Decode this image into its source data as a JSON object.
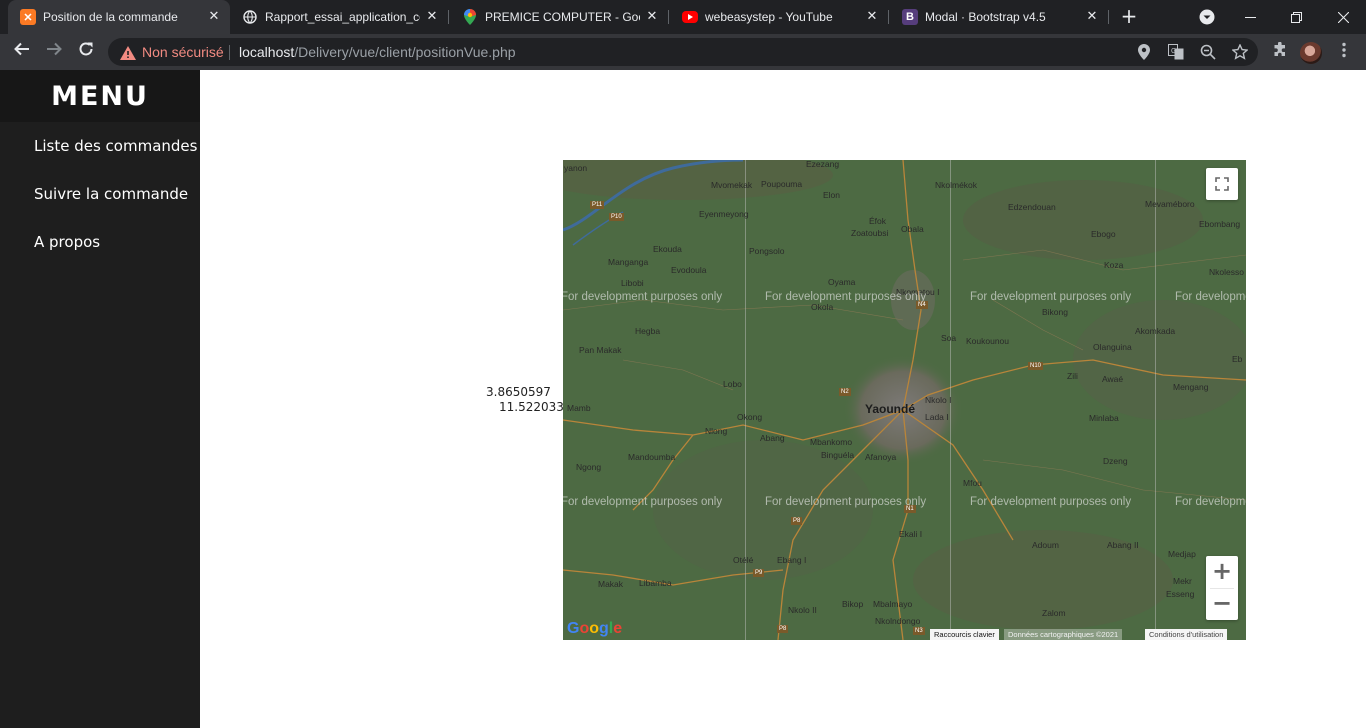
{
  "tabs": [
    {
      "title": "Position de la commande",
      "icon": "xampp-icon",
      "color": "#fb7a24",
      "active": true
    },
    {
      "title": "Rapport_essai_application_co",
      "icon": "globe-icon",
      "color": "#e8eaed"
    },
    {
      "title": "PREMICE COMPUTER - Googl",
      "icon": "google-maps-icon",
      "color": "#34a853"
    },
    {
      "title": "webeasystep - YouTube",
      "icon": "youtube-icon",
      "color": "#ff0000"
    },
    {
      "title": "Modal · Bootstrap v4.5",
      "icon": "bootstrap-icon",
      "color": "#563d7c"
    }
  ],
  "address_bar": {
    "security_label": "Non sécurisé",
    "url_host": "localhost",
    "url_path": "/Delivery/vue/client/positionVue.php"
  },
  "sidebar": {
    "heading": "MENU",
    "items": [
      {
        "label": "Liste des commandes"
      },
      {
        "label": "Suivre la commande"
      },
      {
        "label": "A propos"
      }
    ]
  },
  "position": {
    "latitude": "3.8650597",
    "longitude": "11.5220332"
  },
  "map": {
    "center_label": "Yaoundé",
    "watermark": "For development purposes only",
    "places": [
      "Ezezang",
      "Mvomekak",
      "Poupouma",
      "Nkolmékok",
      "Edzendouan",
      "Mevaméboro",
      "Eyenmeyong",
      "Elon",
      "Éfok",
      "Zoatoubsi",
      "Obala",
      "Ebogo",
      "Ebombang",
      "Ekouda",
      "Manganga",
      "Evodoula",
      "Pongsolo",
      "Koza",
      "Nkolesso",
      "Libobi",
      "Oyama",
      "Nkometou I",
      "Okola",
      "Bikong",
      "Hegba",
      "Soa",
      "Koukounou",
      "Akomkada",
      "Olanguina",
      "Pan Makak",
      "Zili",
      "Awaé",
      "Mengang",
      "Lobo",
      "Nkolo I",
      "Mamb",
      "Okong",
      "Lada I",
      "Minlaba",
      "Nlong",
      "Abang",
      "Mbankomo",
      "Mandoumba",
      "Binguéla",
      "Afanoya",
      "Dzeng",
      "Ngong",
      "Mfou",
      "Adoum",
      "Abang II",
      "Medjap",
      "Otélé",
      "Ebang I",
      "Ekali I",
      "Makak",
      "Libamba",
      "Mekr",
      "Esseng",
      "Bikop",
      "Mbalmayo",
      "Zalom",
      "Nkolo II",
      "Nkolndongo",
      "yanon",
      "Eb"
    ],
    "roads": [
      "P11",
      "P10",
      "N4",
      "N2",
      "N10",
      "N1",
      "P8",
      "P9",
      "N3",
      "P8"
    ],
    "attribution": {
      "shortcuts": "Raccourcis clavier",
      "data": "Données cartographiques ©2021",
      "terms": "Conditions d'utilisation"
    },
    "google_logo": "Google",
    "zoom_in": "+",
    "zoom_out": "−"
  }
}
